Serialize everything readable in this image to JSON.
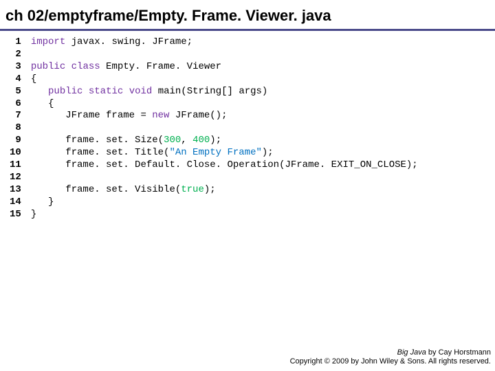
{
  "title": "ch 02/emptyframe/Empty. Frame. Viewer. java",
  "code": {
    "line_numbers": [
      " 1",
      " 2",
      " 3",
      " 4",
      " 5",
      " 6",
      " 7",
      " 8",
      " 9",
      "10",
      "11",
      "12",
      "13",
      "14",
      "15"
    ],
    "tokens": [
      [
        {
          "t": "import",
          "c": "kw"
        },
        {
          "t": " javax. swing. JFrame;"
        }
      ],
      [
        {
          "t": ""
        }
      ],
      [
        {
          "t": "public",
          "c": "kw"
        },
        {
          "t": " "
        },
        {
          "t": "class",
          "c": "kw"
        },
        {
          "t": " Empty. Frame. Viewer"
        }
      ],
      [
        {
          "t": "{"
        }
      ],
      [
        {
          "t": "   "
        },
        {
          "t": "public",
          "c": "kw"
        },
        {
          "t": " "
        },
        {
          "t": "static",
          "c": "kw"
        },
        {
          "t": " "
        },
        {
          "t": "void",
          "c": "kw"
        },
        {
          "t": " main(String[] args)"
        }
      ],
      [
        {
          "t": "   {"
        }
      ],
      [
        {
          "t": "      JFrame frame = "
        },
        {
          "t": "new",
          "c": "kw"
        },
        {
          "t": " JFrame();"
        }
      ],
      [
        {
          "t": ""
        }
      ],
      [
        {
          "t": "      frame. set. Size("
        },
        {
          "t": "300",
          "c": "num"
        },
        {
          "t": ", "
        },
        {
          "t": "400",
          "c": "num"
        },
        {
          "t": ");"
        }
      ],
      [
        {
          "t": "      frame. set. Title("
        },
        {
          "t": "\"An Empty Frame\"",
          "c": "str"
        },
        {
          "t": ");"
        }
      ],
      [
        {
          "t": "      frame. set. Default. Close. Operation(JFrame. EXIT_ON_CLOSE);"
        }
      ],
      [
        {
          "t": ""
        }
      ],
      [
        {
          "t": "      frame. set. Visible("
        },
        {
          "t": "true",
          "c": "num"
        },
        {
          "t": ");"
        }
      ],
      [
        {
          "t": "   }"
        }
      ],
      [
        {
          "t": "}"
        }
      ]
    ]
  },
  "footer": {
    "book": "Big Java",
    "by": " by Cay Horstmann",
    "copyright": "Copyright © 2009 by John Wiley & Sons. All rights reserved."
  }
}
